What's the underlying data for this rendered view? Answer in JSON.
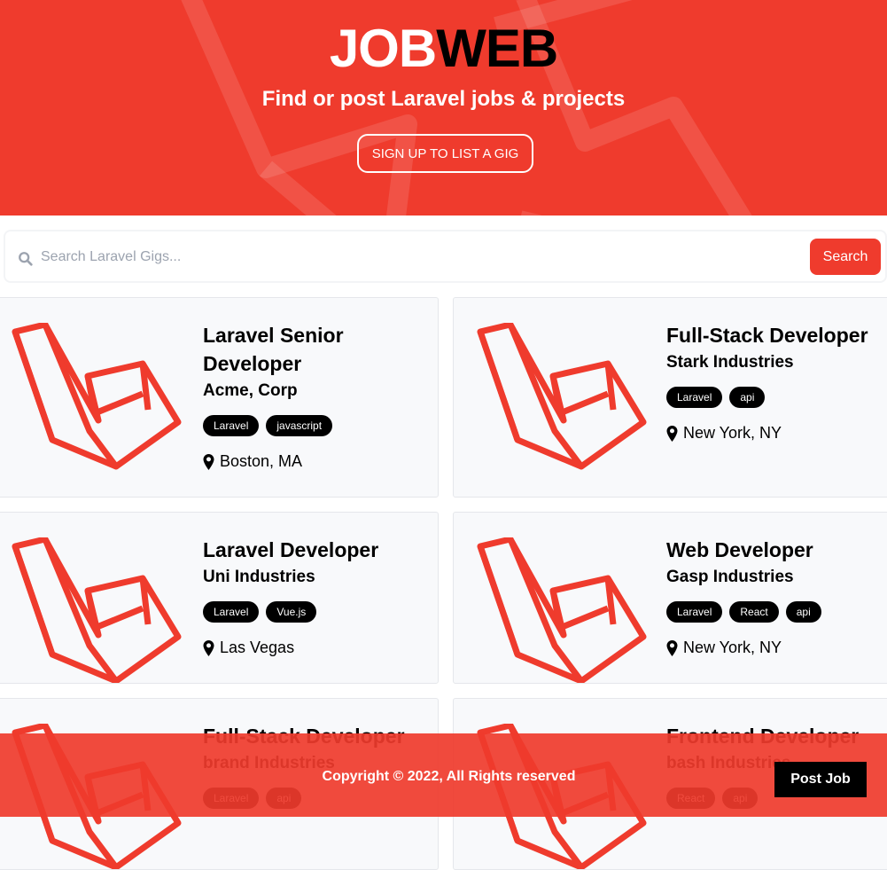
{
  "colors": {
    "brand_red": "#ef3b2d",
    "tag_bg": "#000000",
    "card_bg": "#f8f9fb"
  },
  "hero": {
    "brand_part1": "JOB",
    "brand_part2": "WEB",
    "tagline": "Find or post Laravel jobs & projects",
    "signup_label": "Sign Up to List a Gig"
  },
  "search": {
    "placeholder": "Search Laravel Gigs...",
    "button_label": "Search",
    "icon": "search-icon"
  },
  "listings": [
    {
      "title": "Laravel Senior Developer",
      "company": "Acme, Corp",
      "tags": [
        "Laravel",
        "javascript"
      ],
      "location": "Boston, MA"
    },
    {
      "title": "Full-Stack Developer",
      "company": "Stark Industries",
      "tags": [
        "Laravel",
        "api"
      ],
      "location": "New York, NY"
    },
    {
      "title": "Laravel Developer",
      "company": "Uni Industries",
      "tags": [
        "Laravel",
        "Vue.js"
      ],
      "location": "Las Vegas"
    },
    {
      "title": "Web Developer",
      "company": "Gasp Industries",
      "tags": [
        "Laravel",
        "React",
        "api"
      ],
      "location": "New York, NY"
    },
    {
      "title": "Full-Stack Developer",
      "company": "brand Industries",
      "tags": [
        "Laravel",
        "api"
      ],
      "location": ""
    },
    {
      "title": "Frontend Developer",
      "company": "bash Industries",
      "tags": [
        "React",
        "api"
      ],
      "location": ""
    }
  ],
  "footer": {
    "copyright": "Copyright © 2022, All Rights reserved",
    "post_job_label": "Post Job"
  }
}
